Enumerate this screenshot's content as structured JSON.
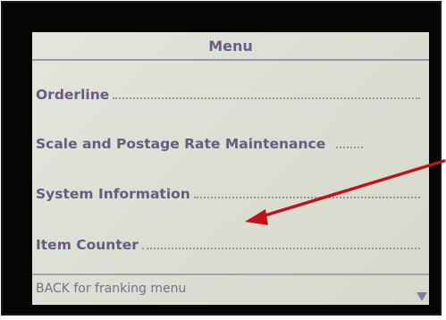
{
  "menu": {
    "title": "Menu",
    "items": [
      {
        "label": "Orderline"
      },
      {
        "label": "Scale and Postage Rate Maintenance"
      },
      {
        "label": "System Information"
      },
      {
        "label": "Item Counter"
      }
    ],
    "footer": "BACK for franking menu"
  },
  "colors": {
    "screen_bg": "#dcdfd3",
    "text": "#6a5a82",
    "annotation_arrow": "#c0121b",
    "bezel": "#050505"
  },
  "icons": {
    "scroll": "triangle-down-icon",
    "annotation": "red-arrow-icon"
  }
}
